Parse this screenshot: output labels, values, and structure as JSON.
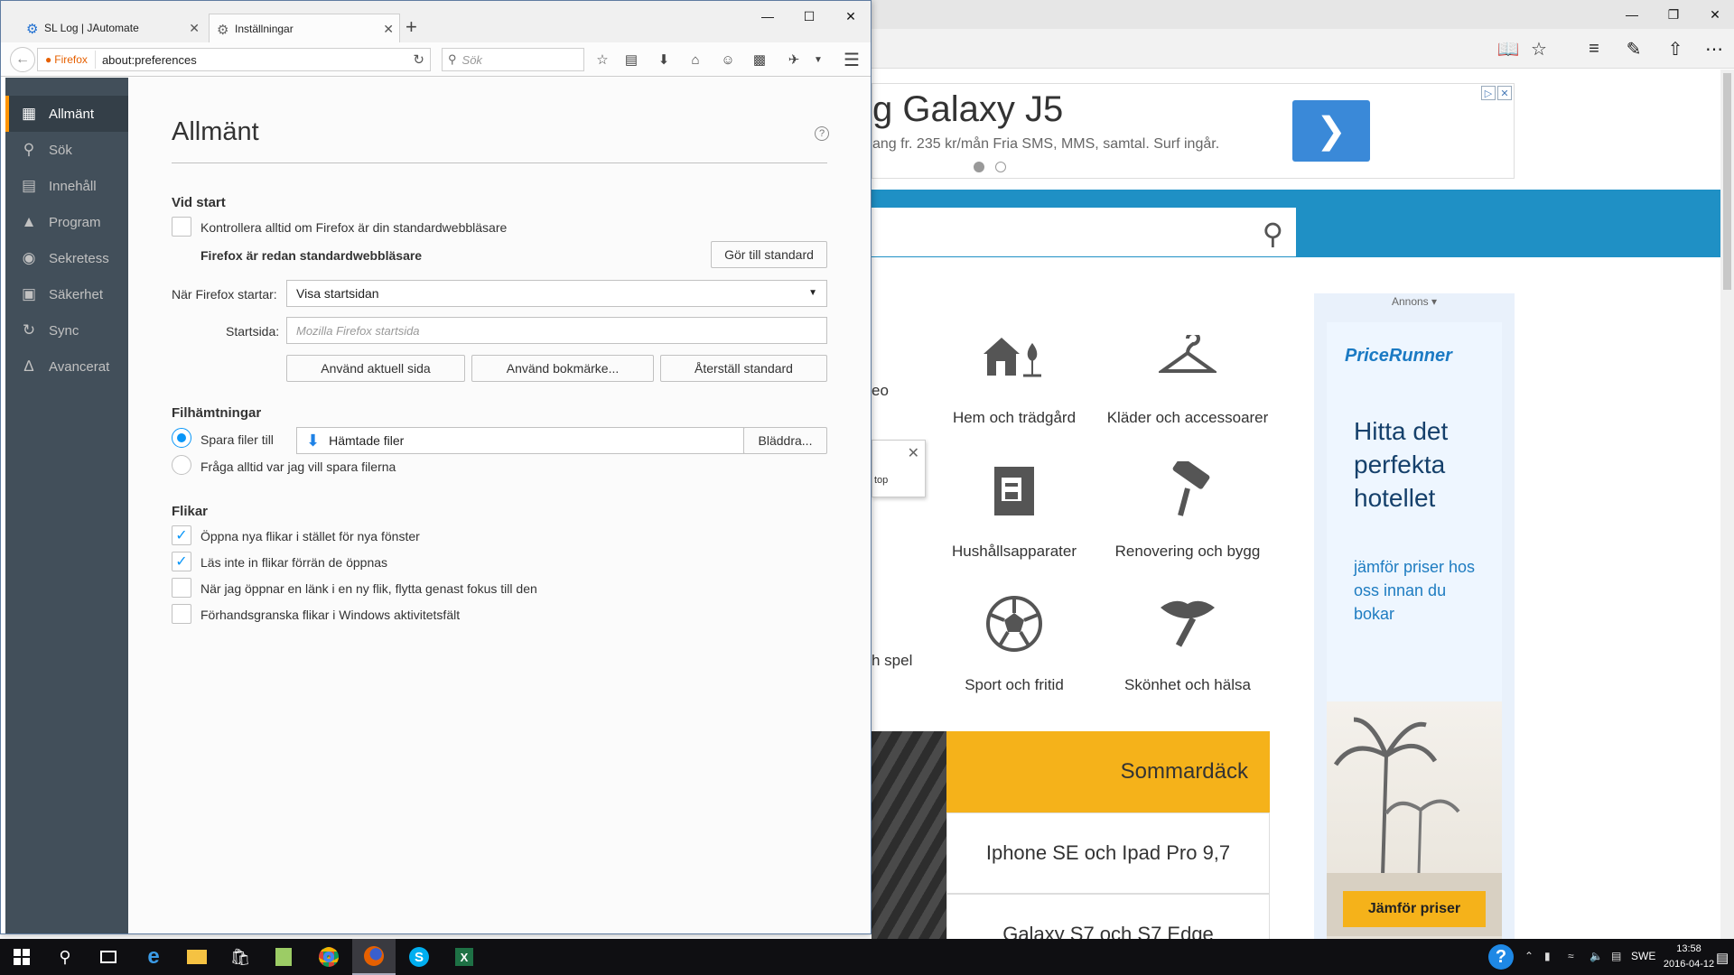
{
  "edge": {
    "ad": {
      "title": "g Galaxy J5",
      "subtitle": "ang fr. 235 kr/mån Fria SMS, MMS, samtal. Surf ingår."
    },
    "categories": [
      {
        "label": "Hem och trädgård"
      },
      {
        "label": "Kläder och accessoarer"
      },
      {
        "label": "Hushållsapparater"
      },
      {
        "label": "Renovering och bygg"
      },
      {
        "label": "Sport och fritid"
      },
      {
        "label": "Skönhet och hälsa"
      }
    ],
    "partial_labels": [
      "eo",
      "h spel"
    ],
    "popup_text": "top",
    "promo": {
      "highlight": "Sommardäck",
      "rows": [
        "Iphone SE och Ipad Pro 9,7",
        "Galaxy S7 och S7 Edge"
      ]
    },
    "side_ad": {
      "annons": "Annons ▾",
      "logo": "PriceRunner",
      "headline": "Hitta det perfekta hotellet",
      "sub": "jämför priser hos oss innan du bokar",
      "button": "Jämför priser"
    }
  },
  "firefox": {
    "tabs": [
      {
        "title": "SL Log | JAutomate",
        "active": false
      },
      {
        "title": "Inställningar",
        "active": true
      }
    ],
    "identity": "Firefox",
    "url": "about:preferences",
    "search_placeholder": "Sök",
    "sidebar": [
      {
        "label": "Allmänt",
        "icon": "general-icon",
        "selected": true
      },
      {
        "label": "Sök",
        "icon": "search-icon",
        "selected": false
      },
      {
        "label": "Innehåll",
        "icon": "content-icon",
        "selected": false
      },
      {
        "label": "Program",
        "icon": "applications-icon",
        "selected": false
      },
      {
        "label": "Sekretess",
        "icon": "privacy-mask-icon",
        "selected": false
      },
      {
        "label": "Säkerhet",
        "icon": "lock-icon",
        "selected": false
      },
      {
        "label": "Sync",
        "icon": "sync-icon",
        "selected": false
      },
      {
        "label": "Avancerat",
        "icon": "advanced-icon",
        "selected": false
      }
    ],
    "prefs": {
      "title": "Allmänt",
      "startup": {
        "heading": "Vid start",
        "check_default": "Kontrollera alltid om Firefox är din standardwebbläsare",
        "already_default": "Firefox är redan standardwebbläsare",
        "make_default_btn": "Gör till standard",
        "when_starts_label": "När Firefox startar:",
        "when_starts_value": "Visa startsidan",
        "homepage_label": "Startsida:",
        "homepage_placeholder": "Mozilla Firefox startsida",
        "use_current_btn": "Använd aktuell sida",
        "use_bookmark_btn": "Använd bokmärke...",
        "restore_btn": "Återställ standard"
      },
      "downloads": {
        "heading": "Filhämtningar",
        "save_to_label": "Spara filer till",
        "save_to_value": "Hämtade filer",
        "browse_btn": "Bläddra...",
        "always_ask_label": "Fråga alltid var jag vill spara filerna",
        "save_to_selected": true
      },
      "tabs": {
        "heading": "Flikar",
        "items": [
          {
            "label": "Öppna nya flikar i stället för nya fönster",
            "checked": true
          },
          {
            "label": "Läs inte in flikar förrän de öppnas",
            "checked": true
          },
          {
            "label": "När jag öppnar en länk i en ny flik, flytta genast fokus till den",
            "checked": false
          },
          {
            "label": "Förhandsgranska flikar i Windows aktivitetsfält",
            "checked": false
          }
        ]
      }
    }
  },
  "taskbar": {
    "language": "SWE",
    "time": "13:58",
    "date": "2016-04-12"
  },
  "colors": {
    "ff_sidebar": "#424f5a",
    "ff_accent": "#ff9500",
    "checkbox_blue": "#0996f8",
    "site_blue": "#1f90c5",
    "promo_yellow": "#f5b21a"
  }
}
